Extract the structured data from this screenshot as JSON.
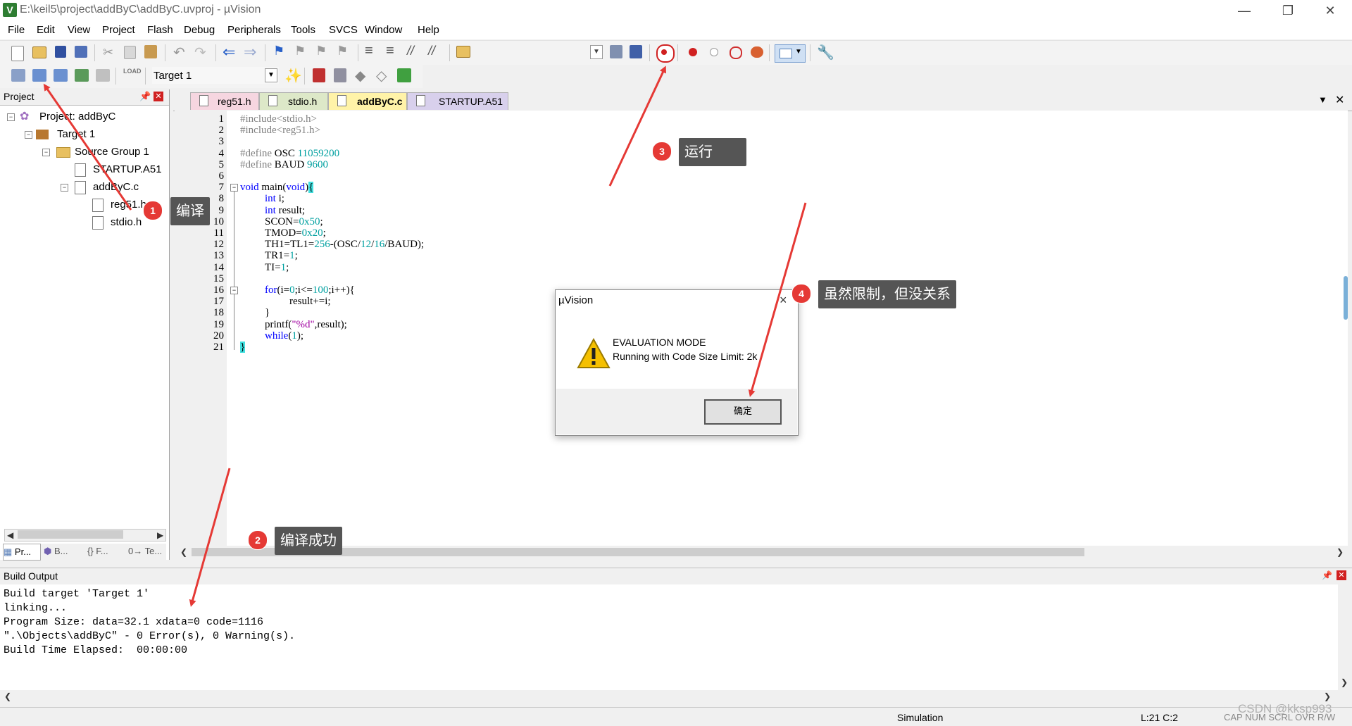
{
  "title": "E:\\keil5\\project\\addByC\\addByC.uvproj - µVision",
  "app_icon": "V",
  "menu": [
    "File",
    "Edit",
    "View",
    "Project",
    "Flash",
    "Debug",
    "Peripherals",
    "Tools",
    "SVCS",
    "Window",
    "Help"
  ],
  "toolbar2": {
    "target": "Target 1"
  },
  "project_panel": {
    "title": "Project",
    "tree": {
      "project": "Project: addByC",
      "target": "Target 1",
      "group": "Source Group 1",
      "startup": "STARTUP.A51",
      "main_file": "addByC.c",
      "reg51": "reg51.h",
      "stdio": "stdio.h"
    },
    "bottom_tabs": [
      "Pr...",
      "B...",
      "{} F...",
      "0→ Te..."
    ]
  },
  "editor": {
    "tabs": [
      "reg51.h",
      "stdio.h",
      "addByC.c",
      "STARTUP.A51"
    ],
    "active_tab": "addByC.c",
    "line_numbers": [
      "1",
      "2",
      "3",
      "4",
      "5",
      "6",
      "7",
      "8",
      "9",
      "10",
      "11",
      "12",
      "13",
      "14",
      "15",
      "16",
      "17",
      "18",
      "19",
      "20",
      "21"
    ],
    "code": {
      "l1": "#include<stdio.h>",
      "l2": "#include<reg51.h>",
      "l4a": "#define ",
      "l4b": "OSC ",
      "l4c": "11059200",
      "l5a": "#define ",
      "l5b": "BAUD ",
      "l5c": "9600",
      "l7a": "void",
      "l7b": " main(",
      "l7c": "void",
      "l7d": ")",
      "l7e": "{",
      "l8a": "int",
      "l8b": " i;",
      "l9a": "int",
      "l9b": " result;",
      "l10a": "SCON=",
      "l10b": "0x50",
      "l10c": ";",
      "l11a": "TMOD=",
      "l11b": "0x20",
      "l11c": ";",
      "l12a": "TH1=TL1=",
      "l12b": "256",
      "l12c": "-(OSC/",
      "l12d": "12",
      "l12e": "/",
      "l12f": "16",
      "l12g": "/BAUD);",
      "l13a": "TR1=",
      "l13b": "1",
      "l13c": ";",
      "l14a": "TI=",
      "l14b": "1",
      "l14c": ";",
      "l16a": "for",
      "l16b": "(i=",
      "l16c": "0",
      "l16d": ";i<=",
      "l16e": "100",
      "l16f": ";i++){",
      "l17": "result+=i;",
      "l18": "}",
      "l19a": "printf(",
      "l19b": "\"%d\"",
      "l19c": ",result);",
      "l20a": "while",
      "l20b": "(",
      "l20c": "1",
      "l20d": ");",
      "l21": "}"
    }
  },
  "build_output": {
    "title": "Build Output",
    "lines": [
      "Build target 'Target 1'",
      "linking...",
      "Program Size: data=32.1 xdata=0 code=1116",
      "\".\\Objects\\addByC\" - 0 Error(s), 0 Warning(s).",
      "Build Time Elapsed:  00:00:00"
    ]
  },
  "dialog": {
    "title": "µVision",
    "close": "×",
    "message1": "EVALUATION MODE",
    "message2": "Running with Code Size Limit: 2k",
    "ok": "确定"
  },
  "annotations": [
    {
      "num": "1",
      "text": "编译"
    },
    {
      "num": "2",
      "text": "编译成功"
    },
    {
      "num": "3",
      "text": "运行"
    },
    {
      "num": "4",
      "text": "虽然限制，但没关系"
    }
  ],
  "status": {
    "mode": "Simulation",
    "pos": "L:21 C:2",
    "flags": "CAP  NUM  SCRL  OVR  R/W",
    "watermark": "CSDN @kksp993"
  },
  "colors": {
    "annotation": "#e53935",
    "callout_bg": "#555555",
    "active_tab": "#fff3a8",
    "tab_pink": "#f6d6e0",
    "tab_green": "#dde8c8",
    "tab_purple": "#d8d0ec"
  }
}
